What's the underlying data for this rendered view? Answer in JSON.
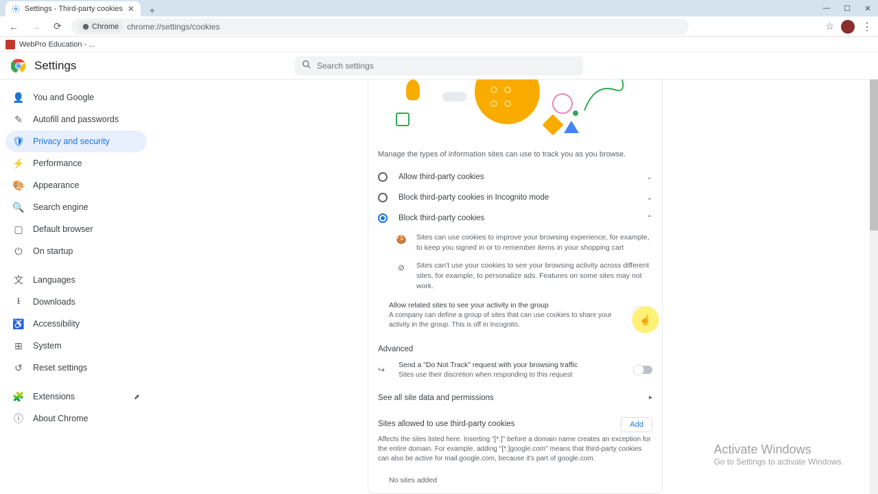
{
  "tab": {
    "title": "Settings - Third-party cookies"
  },
  "address": {
    "chip": "Chrome",
    "url": "chrome://settings/cookies"
  },
  "bookmark": {
    "label": "WebPro Education - ..."
  },
  "header": {
    "title": "Settings"
  },
  "search": {
    "placeholder": "Search settings"
  },
  "sidebar": {
    "items": [
      {
        "label": "You and Google"
      },
      {
        "label": "Autofill and passwords"
      },
      {
        "label": "Privacy and security"
      },
      {
        "label": "Performance"
      },
      {
        "label": "Appearance"
      },
      {
        "label": "Search engine"
      },
      {
        "label": "Default browser"
      },
      {
        "label": "On startup"
      }
    ],
    "group2": [
      {
        "label": "Languages"
      },
      {
        "label": "Downloads"
      },
      {
        "label": "Accessibility"
      },
      {
        "label": "System"
      },
      {
        "label": "Reset settings"
      }
    ],
    "group3": [
      {
        "label": "Extensions"
      },
      {
        "label": "About Chrome"
      }
    ]
  },
  "panel": {
    "desc": "Manage the types of information sites can use to track you as you browse.",
    "options": [
      {
        "label": "Allow third-party cookies"
      },
      {
        "label": "Block third-party cookies in Incognito mode"
      },
      {
        "label": "Block third-party cookies"
      }
    ],
    "sub1": "Sites can use cookies to improve your browsing experience, for example, to keep you signed in or to remember items in your shopping cart",
    "sub2": "Sites can't use your cookies to see your browsing activity across different sites, for example, to personalize ads. Features on some sites may not work.",
    "allow_related_title": "Allow related sites to see your activity in the group",
    "allow_related_desc": "A company can define a group of sites that can use cookies to share your activity in the group. This is off in Incognito.",
    "advanced": "Advanced",
    "dnt_title": "Send a \"Do Not Track\" request with your browsing traffic",
    "dnt_desc": "Sites use their discretion when responding to this request",
    "see_all": "See all site data and permissions",
    "allowed_title": "Sites allowed to use third-party cookies",
    "allowed_desc": "Affects the sites listed here. Inserting \"[*.]\" before a domain name creates an exception for the entire domain. For example, adding \"[*.]google.com\" means that third-party cookies can also be active for mail.google.com, because it's part of google.com.",
    "add": "Add",
    "no_sites": "No sites added"
  },
  "watermark": {
    "t1": "Activate Windows",
    "t2": "Go to Settings to activate Windows."
  }
}
